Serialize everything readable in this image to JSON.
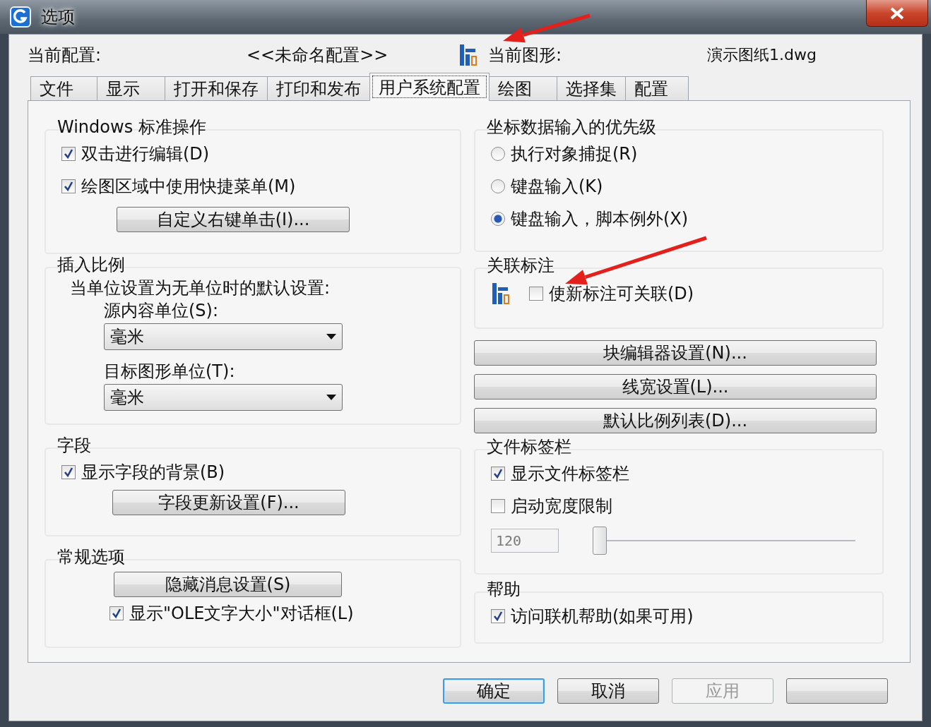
{
  "window": {
    "title": "选项"
  },
  "header": {
    "profile_label": "当前配置:",
    "profile_value": "<<未命名配置>>",
    "drawing_label": "当前图形:",
    "drawing_value": "演示图纸1.dwg"
  },
  "tabs": [
    {
      "label": "文件",
      "selected": false
    },
    {
      "label": "显示",
      "selected": false
    },
    {
      "label": "打开和保存",
      "selected": false
    },
    {
      "label": "打印和发布",
      "selected": false
    },
    {
      "label": "用户系统配置",
      "selected": true
    },
    {
      "label": "绘图",
      "selected": false
    },
    {
      "label": "选择集",
      "selected": false
    },
    {
      "label": "配置",
      "selected": false
    }
  ],
  "left": {
    "windows_ops": {
      "title": "Windows 标准操作",
      "options": [
        {
          "label": "双击进行编辑(D)",
          "checked": true
        },
        {
          "label": "绘图区域中使用快捷菜单(M)",
          "checked": true
        }
      ],
      "button": "自定义右键单击(I)..."
    },
    "insert_scale": {
      "title": "插入比例",
      "note": "当单位设置为无单位时的默认设置:",
      "source_label": "源内容单位(S):",
      "source_value": "毫米",
      "target_label": "目标图形单位(T):",
      "target_value": "毫米"
    },
    "fields": {
      "title": "字段",
      "options": [
        {
          "label": "显示字段的背景(B)",
          "checked": true
        }
      ],
      "button": "字段更新设置(F)..."
    },
    "general": {
      "title": "常规选项",
      "button": "隐藏消息设置(S)",
      "options": [
        {
          "label": "显示\"OLE文字大小\"对话框(L)",
          "checked": true
        }
      ]
    }
  },
  "right": {
    "coord_priority": {
      "title": "坐标数据输入的优先级",
      "options": [
        {
          "label": "执行对象捕捉(R)",
          "selected": false
        },
        {
          "label": "键盘输入(K)",
          "selected": false
        },
        {
          "label": "键盘输入，脚本例外(X)",
          "selected": true
        }
      ]
    },
    "assoc_dim": {
      "title": "关联标注",
      "options": [
        {
          "label": "使新标注可关联(D)",
          "checked": false
        }
      ]
    },
    "buttons": [
      "块编辑器设置(N)...",
      "线宽设置(L)...",
      "默认比例列表(D)..."
    ],
    "file_tabs": {
      "title": "文件标签栏",
      "options": [
        {
          "label": "显示文件标签栏",
          "checked": true
        },
        {
          "label": "启动宽度限制",
          "checked": false
        }
      ],
      "width_value": "120",
      "slider": {
        "level": 0
      }
    },
    "help": {
      "title": "帮助",
      "options": [
        {
          "label": "访问联机帮助(如果可用)",
          "checked": true
        }
      ]
    }
  },
  "footer_buttons": [
    {
      "kind": "text",
      "label": "确定",
      "default": true,
      "disabled": false
    },
    {
      "kind": "text",
      "label": "取消",
      "default": false,
      "disabled": false
    },
    {
      "kind": "text",
      "label": "应用",
      "default": false,
      "disabled": true
    },
    {
      "kind": "blank",
      "default": false,
      "disabled": false
    }
  ],
  "annotations": [
    {
      "kind": "arrow"
    },
    {
      "kind": "arrow"
    }
  ]
}
